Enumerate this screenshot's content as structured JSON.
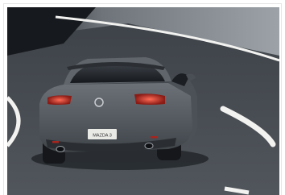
{
  "photo": {
    "subject": "car-rear-photo",
    "plate_text": "MAZDA 3",
    "colors": {
      "road": "#4b5056",
      "road_dark": "#2c3035",
      "wall": "#8d9399",
      "car_body": "#5b6167",
      "car_dark": "#262a2f",
      "glass": "#1c1f24",
      "taillight": "#c8352c",
      "lane_marking": "#f4f4f2"
    }
  }
}
